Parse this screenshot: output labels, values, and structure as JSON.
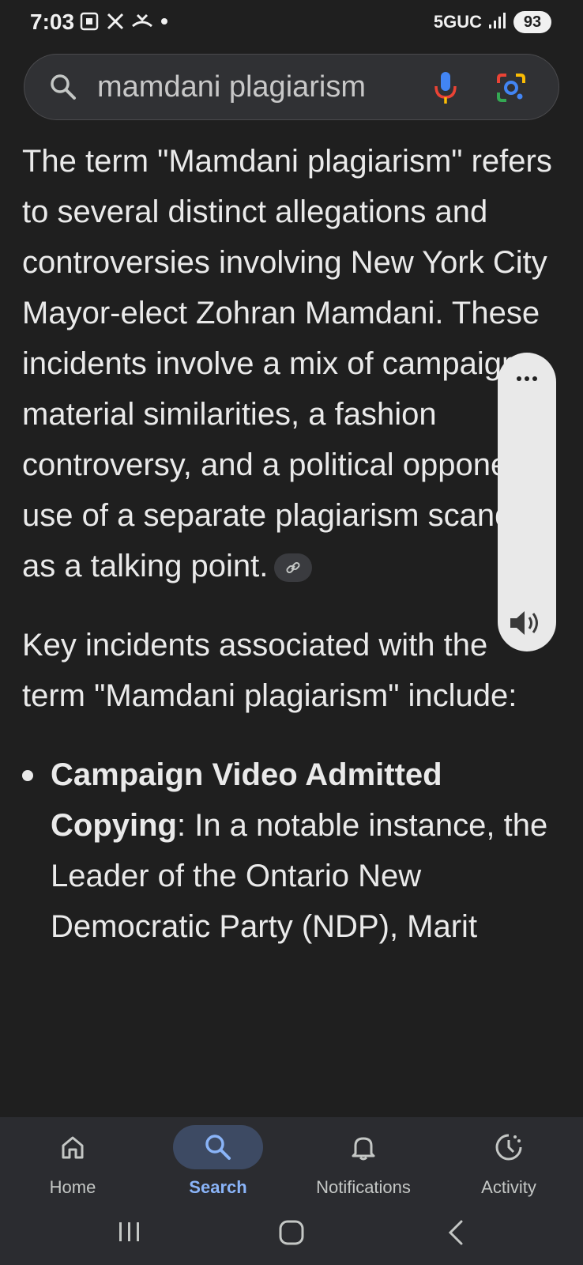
{
  "status_bar": {
    "time": "7:03",
    "network": "5GUC",
    "battery": "93",
    "icons_left": [
      "screenshot-icon",
      "x-app-icon",
      "missed-call-icon",
      "dot-icon"
    ],
    "icons_right": [
      "signal-icon",
      "battery-icon"
    ]
  },
  "search": {
    "query": "mamdani plagiarism",
    "icons": [
      "search-icon",
      "microphone-icon",
      "google-lens-icon"
    ]
  },
  "content": {
    "paragraph1": "The term \"Mamdani plagiarism\" refers to several distinct allegations and controversies involving New York City Mayor-elect Zohran Mamdani. These incidents involve a mix of campaign material similarities, a fashion controversy, and a political opponent's use of a separate plagiarism scandal as a talking point.",
    "paragraph2": "Key incidents associated with the term \"Mamdani plagiarism\" include:",
    "bullets": [
      {
        "title": "Campaign Video Admitted Copying",
        "text": ": In a notable instance, the Leader of the Ontario New Democratic Party (NDP), Marit"
      }
    ]
  },
  "floating_panel": {
    "icons": [
      "more-options-icon",
      "speaker-icon"
    ]
  },
  "bottom_nav": {
    "items": [
      {
        "label": "Home",
        "icon": "home-icon",
        "active": false
      },
      {
        "label": "Search",
        "icon": "search-icon",
        "active": true
      },
      {
        "label": "Notifications",
        "icon": "bell-icon",
        "active": false
      },
      {
        "label": "Activity",
        "icon": "activity-icon",
        "active": false
      }
    ]
  },
  "system_nav": {
    "icons": [
      "recents-icon",
      "home-circle-icon",
      "back-icon"
    ]
  },
  "colors": {
    "background": "#1f1f1f",
    "search_bar": "#303134",
    "active_nav": "#8ab4f8",
    "nav_background": "#2b2c30"
  }
}
